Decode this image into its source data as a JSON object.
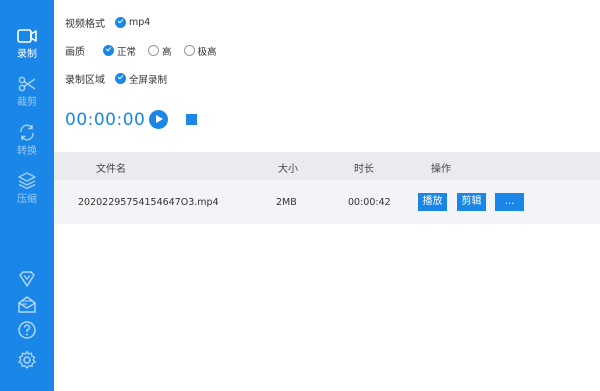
{
  "sidebar": {
    "items": [
      {
        "label": "录制",
        "icon": "video-camera-icon"
      },
      {
        "label": "裁剪",
        "icon": "scissors-icon"
      },
      {
        "label": "转换",
        "icon": "convert-icon"
      },
      {
        "label": "压缩",
        "icon": "compress-layers-icon"
      }
    ],
    "bottom_icons": [
      "diamond-icon",
      "mail-icon",
      "help-icon",
      "settings-icon"
    ],
    "accent": "#1a87e8"
  },
  "settings": {
    "format": {
      "label": "视频格式",
      "option": "mp4"
    },
    "quality": {
      "label": "画质",
      "options": [
        "正常",
        "高",
        "极高"
      ],
      "selected": "正常"
    },
    "region": {
      "label": "录制区域",
      "option": "全屏录制"
    }
  },
  "timer": "00:00:00",
  "table": {
    "headers": [
      "文件名",
      "大小",
      "时长",
      "操作"
    ],
    "rows": [
      {
        "name": "20202295754154647O3.mp4",
        "size": "2MB",
        "duration": "00:00:42",
        "actions": [
          "播放",
          "剪辑",
          "..."
        ]
      }
    ]
  }
}
